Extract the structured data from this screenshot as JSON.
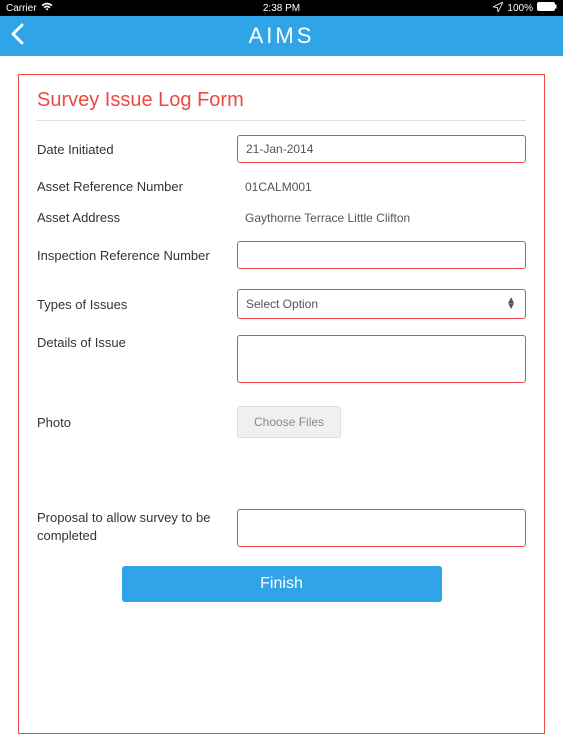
{
  "status": {
    "carrier": "Carrier",
    "time": "2:38 PM",
    "battery": "100%"
  },
  "nav": {
    "title": "AIMS"
  },
  "form": {
    "title": "Survey Issue Log Form",
    "labels": {
      "date_initiated": "Date Initiated",
      "asset_ref": "Asset Reference Number",
      "asset_address": "Asset Address",
      "inspection_ref": "Inspection Reference Number",
      "types_of_issues": "Types of Issues",
      "details": "Details of Issue",
      "photo": "Photo",
      "proposal": "Proposal to allow survey to be completed"
    },
    "values": {
      "date_initiated": "21-Jan-2014",
      "asset_ref": "01CALM001",
      "asset_address": "Gaythorne Terrace Little Clifton",
      "inspection_ref": "",
      "types_of_issues_placeholder": "Select Option",
      "details": "",
      "choose_files_label": "Choose Files",
      "proposal": ""
    },
    "finish_label": "Finish"
  }
}
